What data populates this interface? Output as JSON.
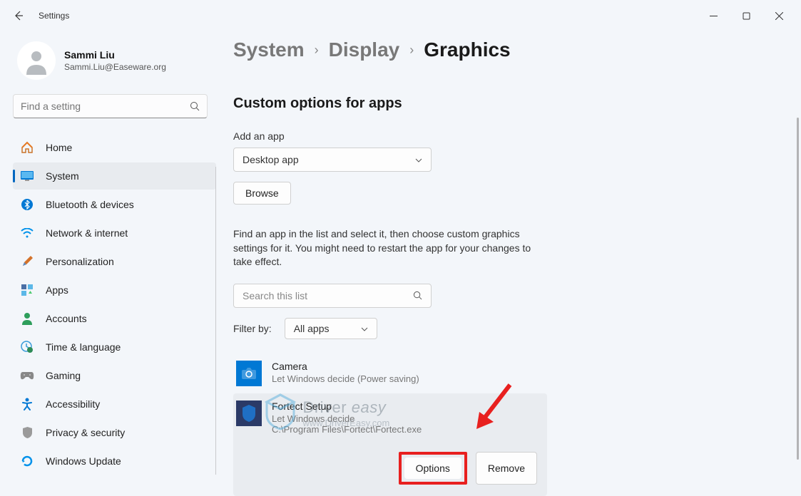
{
  "window": {
    "title": "Settings"
  },
  "profile": {
    "name": "Sammi Liu",
    "email": "Sammi.Liu@Easeware.org"
  },
  "search": {
    "placeholder": "Find a setting"
  },
  "nav": [
    {
      "label": "Home"
    },
    {
      "label": "System"
    },
    {
      "label": "Bluetooth & devices"
    },
    {
      "label": "Network & internet"
    },
    {
      "label": "Personalization"
    },
    {
      "label": "Apps"
    },
    {
      "label": "Accounts"
    },
    {
      "label": "Time & language"
    },
    {
      "label": "Gaming"
    },
    {
      "label": "Accessibility"
    },
    {
      "label": "Privacy & security"
    },
    {
      "label": "Windows Update"
    }
  ],
  "breadcrumb": {
    "level1": "System",
    "level2": "Display",
    "level3": "Graphics"
  },
  "main": {
    "section_title": "Custom options for apps",
    "add_app_label": "Add an app",
    "app_type_selected": "Desktop app",
    "browse_label": "Browse",
    "help_text": "Find an app in the list and select it, then choose custom graphics settings for it. You might need to restart the app for your changes to take effect.",
    "search_list_placeholder": "Search this list",
    "filter_label": "Filter by:",
    "filter_selected": "All apps",
    "apps": [
      {
        "name": "Camera",
        "status": "Let Windows decide (Power saving)"
      },
      {
        "name": "Fortect Setup",
        "status": "Let Windows decide",
        "path": "C:\\Program Files\\Fortect\\Fortect.exe"
      }
    ],
    "options_label": "Options",
    "remove_label": "Remove"
  },
  "watermark": {
    "brand_upper": "Driver ",
    "brand_em": "easy",
    "url": "www.DriverEasy.com"
  }
}
